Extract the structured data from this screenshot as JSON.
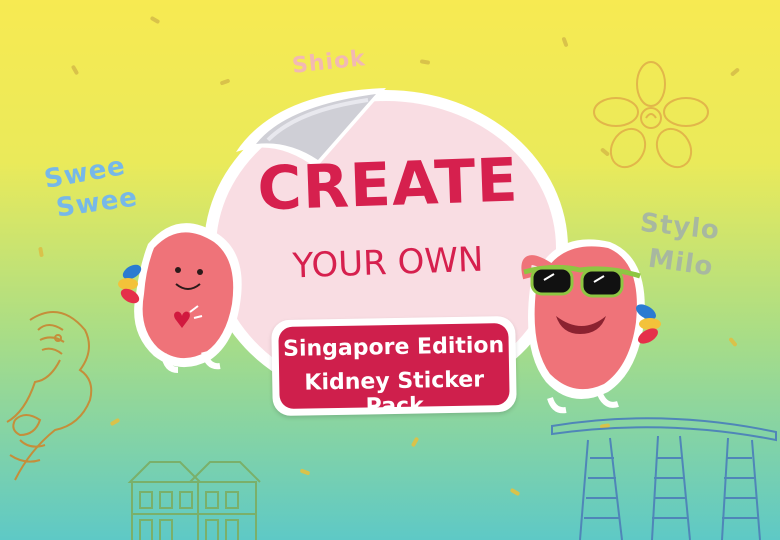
{
  "graphic": {
    "title_line1": "CREATE",
    "title_line2": "YOUR OWN",
    "banner_line1": "Singapore Edition",
    "banner_line2": "Kidney Sticker Pack"
  },
  "doodles": {
    "shiok": "Shiok",
    "swee_line1": "Swee",
    "swee_line2": "Swee",
    "stylo_line1": "Stylo",
    "stylo_line2": "Milo"
  },
  "colors": {
    "background_top": "#f7ea52",
    "background_bottom": "#5ec9c6",
    "title_red": "#d6204e",
    "banner_red": "#cf1f4c",
    "badge_pink": "#f9dde3",
    "kidney_pink": "#ef7379"
  },
  "icons": [
    "merlion-icon",
    "orchid-icon",
    "marina-bay-sands-icon",
    "shophouse-icon",
    "peeling-sticker-icon",
    "kidney-mascot-icon",
    "sunglasses-icon",
    "heart-icon"
  ]
}
